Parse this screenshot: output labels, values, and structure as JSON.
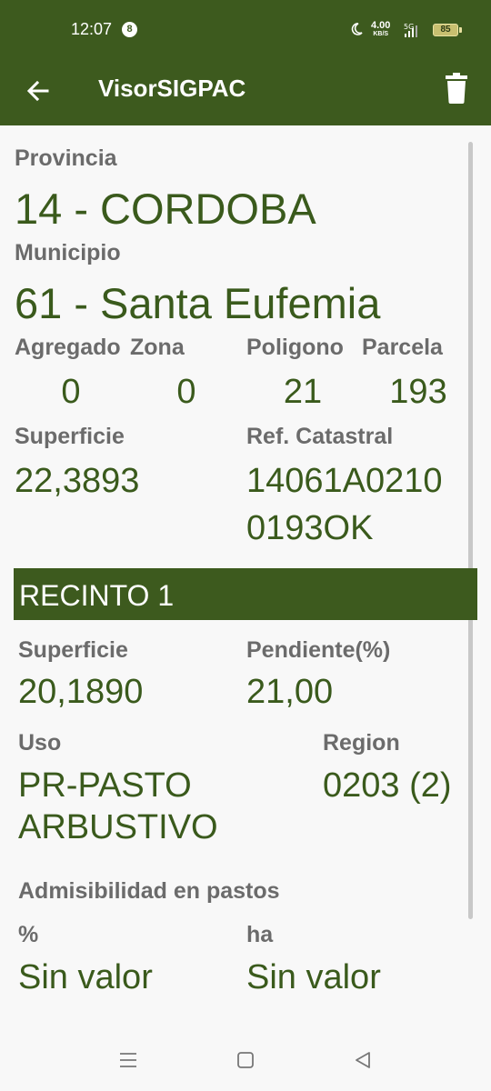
{
  "status": {
    "time": "12:07",
    "notif_count": "8",
    "speed_value": "4.00",
    "speed_unit": "KB/S",
    "network": "5G",
    "battery": "85"
  },
  "appbar": {
    "title": "VisorSIGPAC",
    "back_icon": "arrow-left-icon",
    "delete_icon": "trash-icon"
  },
  "parcel": {
    "provincia_label": "Provincia",
    "provincia_value": "14 - CORDOBA",
    "municipio_label": "Municipio",
    "municipio_value": "61 - Santa Eufemia",
    "agregado_label": "Agregado",
    "agregado_value": "0",
    "zona_label": "Zona",
    "zona_value": "0",
    "poligono_label": "Poligono",
    "poligono_value": "21",
    "parcela_label": "Parcela",
    "parcela_value": "193",
    "superficie_label": "Superficie",
    "superficie_value": "22,3893",
    "ref_label": "Ref. Catastral",
    "ref_line1": "14061A0210",
    "ref_line2": "0193OK"
  },
  "recinto": {
    "title": "RECINTO 1",
    "superficie_label": "Superficie",
    "superficie_value": "20,1890",
    "pendiente_label": "Pendiente(%)",
    "pendiente_value": "21,00",
    "uso_label": "Uso",
    "uso_line1": "PR-PASTO",
    "uso_line2": "ARBUSTIVO",
    "region_label": "Region",
    "region_value": "0203 (2)",
    "admisibilidad_label": "Admisibilidad en pastos",
    "pct_label": "%",
    "pct_value": "Sin valor",
    "ha_label": "ha",
    "ha_value": "Sin valor"
  },
  "colors": {
    "header": "#3d5a1e",
    "value_text": "#3a5a1c",
    "label_text": "#6b6b6b",
    "background": "#f8f8f8"
  },
  "navbar": {
    "menu_icon": "menu-icon",
    "home_icon": "home-square-icon",
    "back_icon": "back-triangle-icon"
  }
}
